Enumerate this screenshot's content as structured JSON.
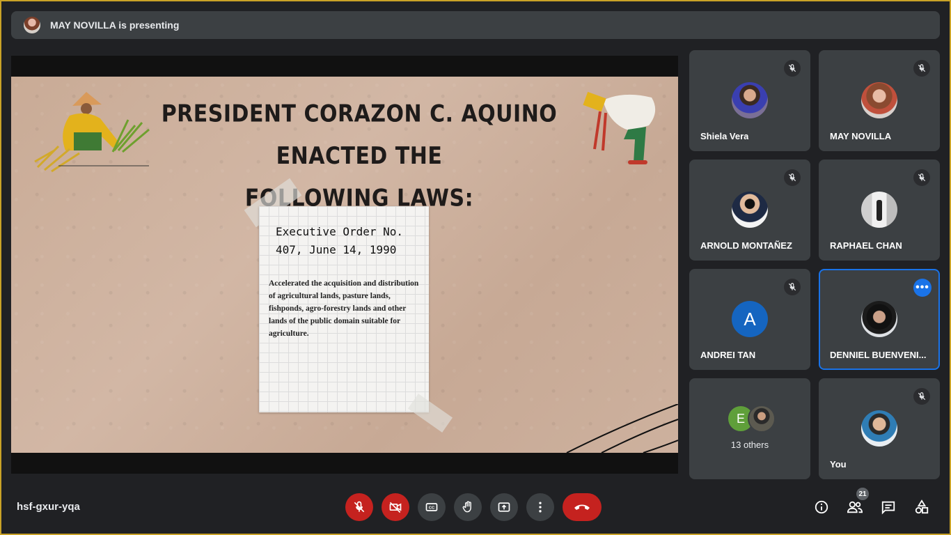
{
  "banner": {
    "text": "MAY NOVILLA is presenting"
  },
  "slide": {
    "title_line1": "PRESIDENT CORAZON C. AQUINO ENACTED THE",
    "title_line2": "FOLLOWING LAWS:",
    "note_heading_line1": "Executive Order No.",
    "note_heading_line2": "407, June 14, 1990",
    "note_body": "Accelerated the acquisition and distribution of agricultural lands, pasture lands, fishponds, agro-forestry lands and other lands of the public domain suitable for agriculture."
  },
  "participants": [
    {
      "name": "Shiela Vera",
      "muted": true,
      "avatar": "photo"
    },
    {
      "name": "MAY NOVILLA",
      "muted": true,
      "avatar": "photo"
    },
    {
      "name": "ARNOLD MONTAÑEZ",
      "muted": true,
      "avatar": "photo"
    },
    {
      "name": "RAPHAEL CHAN",
      "muted": true,
      "avatar": "photo"
    },
    {
      "name": "ANDREI TAN",
      "muted": true,
      "avatar_letter": "A"
    },
    {
      "name": "DENNIEL BUENVENI...",
      "muted": false,
      "active": true,
      "avatar": "photo"
    },
    {
      "others_letter": "E",
      "others_label": "13 others"
    },
    {
      "name": "You",
      "muted": true,
      "avatar": "photo"
    }
  ],
  "toolbar": {
    "meeting_code": "hsf-gxur-yqa",
    "people_count": "21",
    "buttons": [
      "mic-off-icon",
      "camera-off-icon",
      "captions-icon",
      "raise-hand-icon",
      "present-icon",
      "more-options-icon",
      "end-call-icon"
    ],
    "right_buttons": [
      "info-icon",
      "people-icon",
      "chat-icon",
      "activities-icon"
    ]
  },
  "colors": {
    "accent": "#1a73e8",
    "danger": "#c5221f",
    "panel": "#3c4043",
    "background": "#202124"
  }
}
